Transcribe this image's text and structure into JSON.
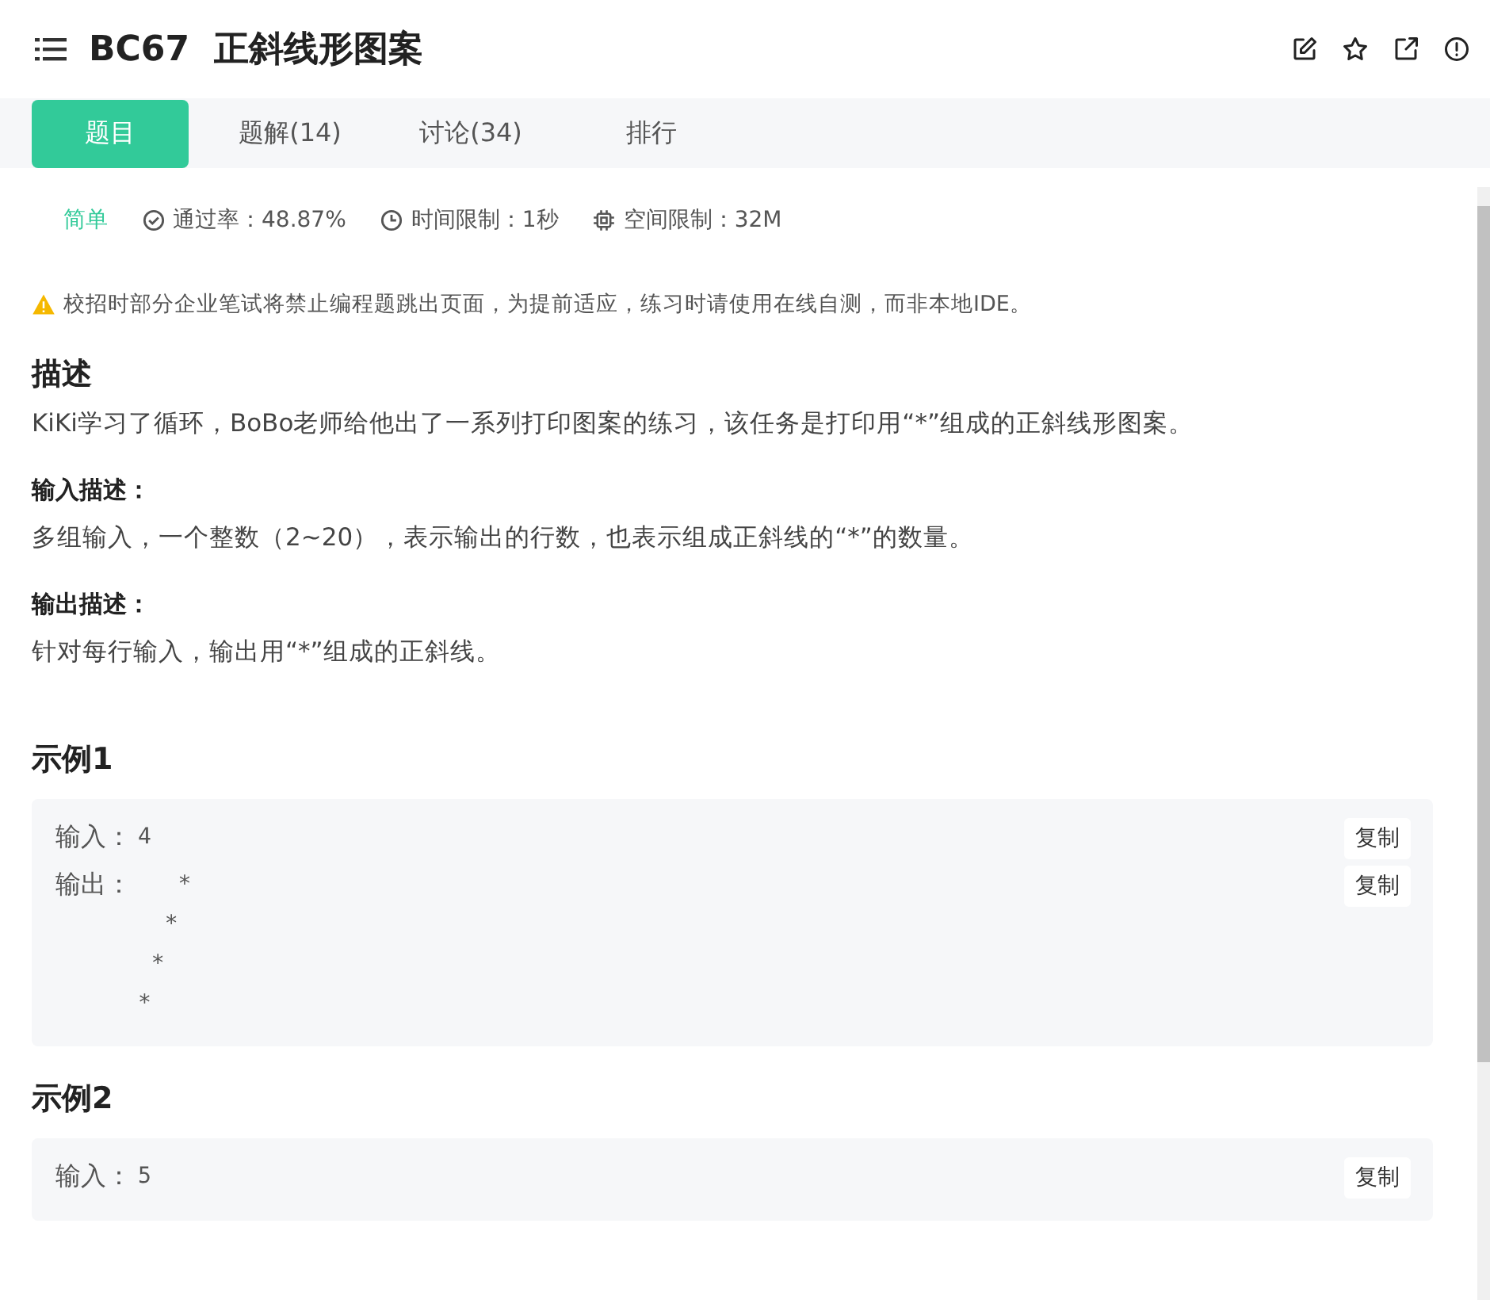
{
  "header": {
    "title": "BC67  正斜线形图案"
  },
  "tabs": [
    {
      "label": "题目",
      "selected": true
    },
    {
      "label": "题解(14)",
      "selected": false
    },
    {
      "label": "讨论(34)",
      "selected": false
    },
    {
      "label": "排行",
      "selected": false
    }
  ],
  "meta": {
    "difficulty": "简单",
    "pass_rate": "通过率：48.87%",
    "time_limit": "时间限制：1秒",
    "memory_limit": "空间限制：32M"
  },
  "notice": "校招时部分企业笔试将禁止编程题跳出页面，为提前适应，练习时请使用在线自测，而非本地IDE。",
  "description": {
    "heading": "描述",
    "text": "KiKi学习了循环，BoBo老师给他出了一系列打印图案的练习，该任务是打印用“*”组成的正斜线形图案。"
  },
  "input_desc": {
    "heading": "输入描述：",
    "text": "多组输入，一个整数（2~20），表示输出的行数，也表示组成正斜线的“*”的数量。"
  },
  "output_desc": {
    "heading": "输出描述：",
    "text": "针对每行输入，输出用“*”组成的正斜线。"
  },
  "examples": [
    {
      "heading": "示例1",
      "rows": [
        {
          "label": "输入：",
          "lines": [
            "4"
          ],
          "copy": "复制"
        },
        {
          "label": "输出：",
          "lines": [
            "   *",
            "  *",
            " *",
            "*"
          ],
          "copy": "复制"
        }
      ]
    },
    {
      "heading": "示例2",
      "rows": [
        {
          "label": "输入：",
          "lines": [
            "5"
          ],
          "copy": "复制"
        }
      ]
    }
  ]
}
